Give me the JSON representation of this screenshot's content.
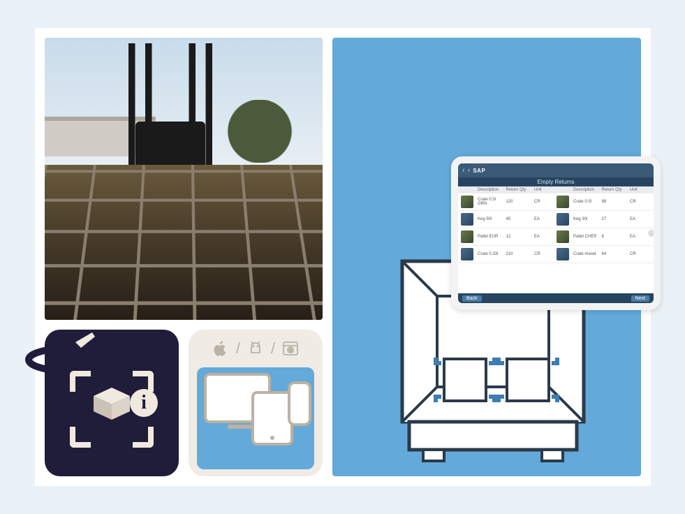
{
  "platforms": {
    "separator": "/"
  },
  "tablet": {
    "brand": "SAP",
    "title": "Empty Returns",
    "columns": [
      "",
      "Description",
      "Return Qty",
      "Unit",
      "",
      "Description",
      "Return Qty",
      "Unit"
    ],
    "footer_left": "Back",
    "footer_right": "Next",
    "rows": [
      {
        "l_name": "Crate 0.5l GRN",
        "l_qty": "120",
        "l_unit": "CR",
        "r_name": "Crate 0.5l",
        "r_qty": "98",
        "r_unit": "CR"
      },
      {
        "l_name": "Keg 50l",
        "l_qty": "45",
        "l_unit": "EA",
        "r_name": "Keg 30l",
        "r_qty": "27",
        "r_unit": "EA"
      },
      {
        "l_name": "Pallet EUR",
        "l_qty": "12",
        "l_unit": "EA",
        "r_name": "Pallet CHEP",
        "r_qty": "8",
        "r_unit": "EA"
      },
      {
        "l_name": "Crate 0.33l",
        "l_qty": "210",
        "l_unit": "CR",
        "r_name": "Crate mixed",
        "r_qty": "64",
        "r_unit": "CR"
      }
    ]
  },
  "info_badge": "i"
}
